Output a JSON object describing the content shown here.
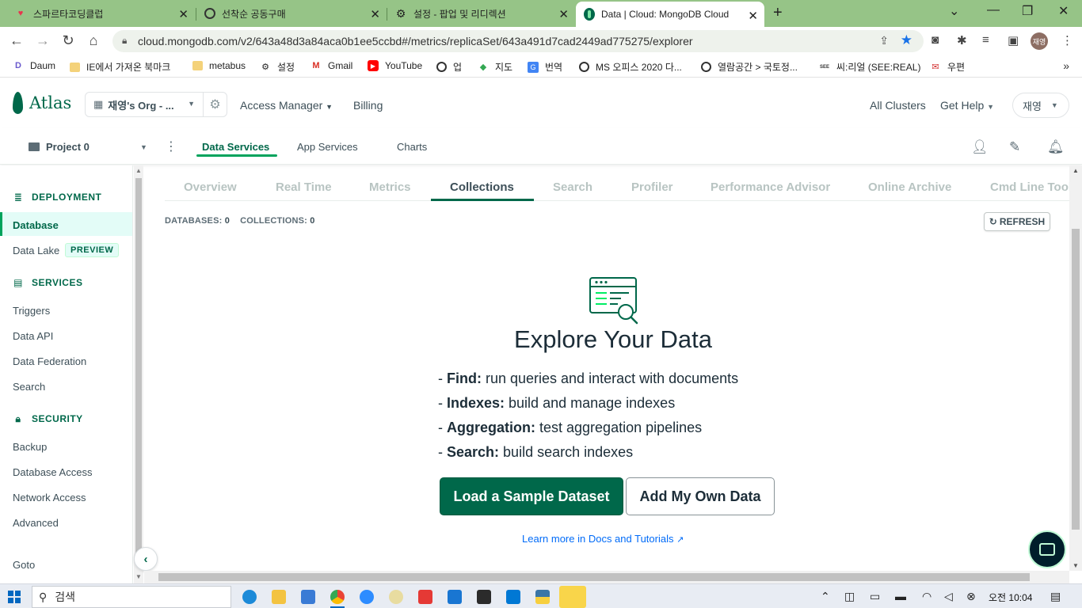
{
  "browser": {
    "tabs": [
      {
        "label": "스파르타코딩클럽",
        "icon": "sparta-heart-icon"
      },
      {
        "label": "선착순 공동구매",
        "icon": "globe-icon"
      },
      {
        "label": "설정 - 팝업 및 리디렉션",
        "icon": "gear-icon"
      },
      {
        "label": "Data | Cloud: MongoDB Cloud",
        "icon": "mongodb-leaf-icon",
        "active": true
      }
    ],
    "address_url": "cloud.mongodb.com/v2/643a48d3a84aca0b1ee5ccbd#/metrics/replicaSet/643a491d7cad2449ad775275/explorer",
    "profile_initials": "재영",
    "bookmarks": [
      {
        "label": "Daum",
        "icon": "daum-icon"
      },
      {
        "label": "IE에서 가져온 북마크",
        "icon": "folder-icon"
      },
      {
        "label": "metabus",
        "icon": "folder-icon"
      },
      {
        "label": "설정",
        "icon": "gear-icon"
      },
      {
        "label": "Gmail",
        "icon": "gmail-icon"
      },
      {
        "label": "YouTube",
        "icon": "youtube-icon"
      },
      {
        "label": "업",
        "icon": "globe-icon"
      },
      {
        "label": "지도",
        "icon": "maps-icon"
      },
      {
        "label": "번역",
        "icon": "translate-icon"
      },
      {
        "label": "MS 오피스 2020 다...",
        "icon": "globe-icon"
      },
      {
        "label": "열람공간 > 국토정...",
        "icon": "globe-icon"
      },
      {
        "label": "씨:리얼 (SEE:REAL)",
        "icon": "seereal-icon"
      },
      {
        "label": "우편",
        "icon": "post-icon"
      }
    ]
  },
  "atlas": {
    "logo_text": "Atlas",
    "org_name": "재영's Org - ...",
    "top_links": [
      "Access Manager",
      "Billing"
    ],
    "right_links": [
      "All Clusters",
      "Get Help"
    ],
    "user_name": "재영",
    "project_name": "Project 0",
    "project_tabs": [
      "Data Services",
      "App Services",
      "Charts"
    ]
  },
  "sidebar": {
    "deployment_heading": "DEPLOYMENT",
    "database": "Database",
    "data_lake": "Data Lake",
    "preview_badge": "PREVIEW",
    "services_heading": "SERVICES",
    "services_items": [
      "Triggers",
      "Data API",
      "Data Federation",
      "Search"
    ],
    "security_heading": "SECURITY",
    "security_items": [
      "Backup",
      "Database Access",
      "Network Access",
      "Advanced"
    ],
    "goto": "Goto"
  },
  "main": {
    "tabs": [
      "Overview",
      "Real Time",
      "Metrics",
      "Collections",
      "Search",
      "Profiler",
      "Performance Advisor",
      "Online Archive",
      "Cmd Line Tools"
    ],
    "active_tab": "Collections",
    "databases_label": "DATABASES:",
    "databases_count": "0",
    "collections_label": "COLLECTIONS:",
    "collections_count": "0",
    "refresh_label": "REFRESH",
    "title": "Explore Your Data",
    "bullets": [
      {
        "term": "Find:",
        "text": " run queries and interact with documents"
      },
      {
        "term": "Indexes:",
        "text": " build and manage indexes"
      },
      {
        "term": "Aggregation:",
        "text": " test aggregation pipelines"
      },
      {
        "term": "Search:",
        "text": " build search indexes"
      }
    ],
    "primary_button": "Load a Sample Dataset",
    "secondary_button": "Add My Own Data",
    "learn_link": "Learn more in Docs and Tutorials"
  },
  "taskbar": {
    "search_placeholder": "검색",
    "clock": "오전 10:04"
  },
  "colors": {
    "tabstrip": "#96c487",
    "mongo_green": "#00684a",
    "accent_green": "#00a35c",
    "link_blue": "#016bf8"
  }
}
